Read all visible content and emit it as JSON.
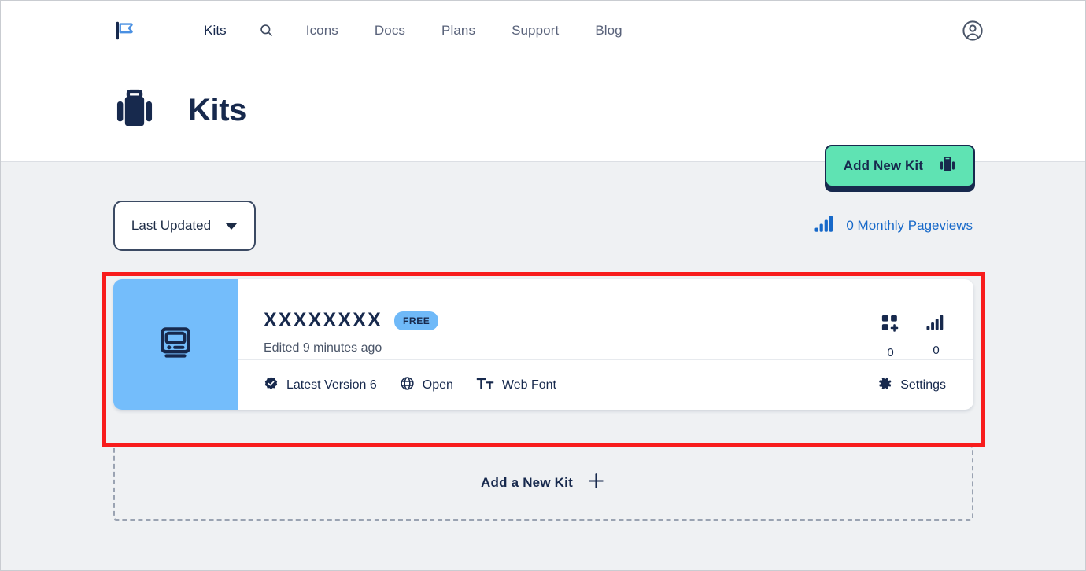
{
  "topnav": {
    "logo_icon": "flag-icon",
    "links": [
      {
        "label": "Kits",
        "active": true
      },
      {
        "label": "Icons",
        "active": false
      },
      {
        "label": "Docs",
        "active": false
      },
      {
        "label": "Plans",
        "active": false
      },
      {
        "label": "Support",
        "active": false
      },
      {
        "label": "Blog",
        "active": false
      }
    ],
    "search_icon": "search-icon",
    "account_icon": "user-circle-icon"
  },
  "header": {
    "icon": "briefcase-icon",
    "title": "Kits",
    "add_button": {
      "label": "Add New Kit",
      "icon": "briefcase-icon",
      "bg": "#5fe3b3",
      "border": "#17294d"
    }
  },
  "toolbar": {
    "sort": {
      "label": "Last Updated",
      "icon": "chevron-down-icon"
    },
    "pageviews": {
      "icon": "bar-chart-icon",
      "label": "0 Monthly Pageviews",
      "color": "#1769c9"
    }
  },
  "kit": {
    "thumbnail": {
      "icon": "classic-computer-icon",
      "bg": "#74bdfb"
    },
    "title": "XXXXXXXX",
    "badge": "FREE",
    "badge_bg": "#6fb9f8",
    "edited": "Edited 9 minutes ago",
    "stats": [
      {
        "icon": "grid-plus-icon",
        "value": "0"
      },
      {
        "icon": "bar-chart-icon",
        "value": "0"
      }
    ],
    "footer_items": [
      {
        "icon": "check-badge-icon",
        "label": "Latest Version 6"
      },
      {
        "icon": "globe-icon",
        "label": "Open"
      },
      {
        "icon": "web-font-icon",
        "label": "Web Font"
      }
    ],
    "settings": {
      "icon": "gear-icon",
      "label": "Settings"
    }
  },
  "add_kit_placeholder": {
    "label": "Add a New Kit",
    "icon": "plus-icon"
  },
  "annotation": {
    "highlight_color": "#f81c1c"
  }
}
